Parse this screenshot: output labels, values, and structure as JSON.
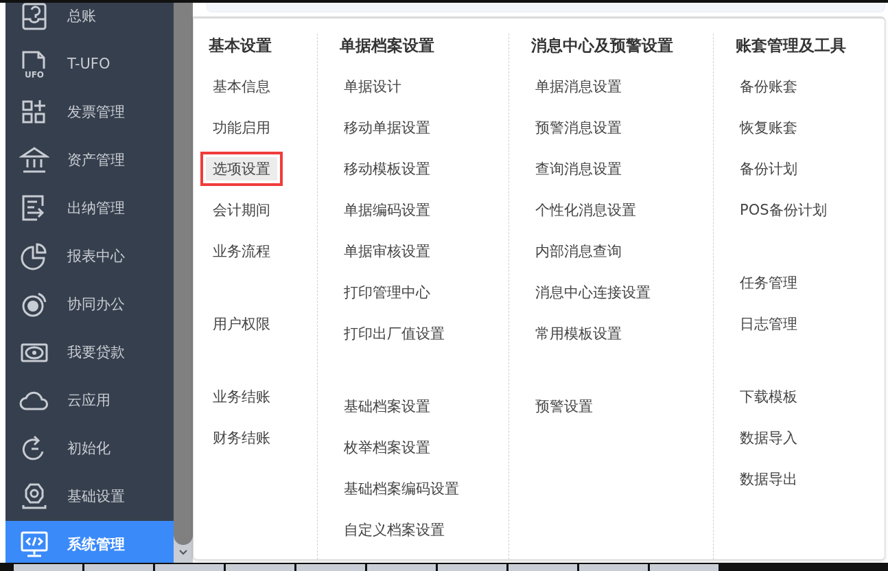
{
  "sidebar": {
    "items": [
      {
        "label": "总账",
        "selected": false
      },
      {
        "label": "T-UFO",
        "icon_label": "UFO",
        "selected": false
      },
      {
        "label": "发票管理",
        "selected": false
      },
      {
        "label": "资产管理",
        "selected": false
      },
      {
        "label": "出纳管理",
        "selected": false
      },
      {
        "label": "报表中心",
        "selected": false
      },
      {
        "label": "协同办公",
        "selected": false
      },
      {
        "label": "我要贷款",
        "selected": false
      },
      {
        "label": "云应用",
        "selected": false
      },
      {
        "label": "初始化",
        "selected": false
      },
      {
        "label": "基础设置",
        "selected": false
      },
      {
        "label": "系统管理",
        "selected": true
      }
    ]
  },
  "menu": {
    "columns": [
      {
        "heading": "基本设置",
        "groups": [
          [
            {
              "label": "基本信息",
              "selected": false
            },
            {
              "label": "功能启用",
              "selected": false
            },
            {
              "label": "选项设置",
              "selected": true
            },
            {
              "label": "会计期间",
              "selected": false
            },
            {
              "label": "业务流程",
              "selected": false
            }
          ],
          [
            {
              "label": "用户权限",
              "selected": false
            }
          ],
          [
            {
              "label": "业务结账",
              "selected": false
            },
            {
              "label": "财务结账",
              "selected": false
            }
          ]
        ]
      },
      {
        "heading": "单据档案设置",
        "groups": [
          [
            {
              "label": "单据设计",
              "selected": false
            },
            {
              "label": "移动单据设置",
              "selected": false
            },
            {
              "label": "移动模板设置",
              "selected": false
            },
            {
              "label": "单据编码设置",
              "selected": false
            },
            {
              "label": "单据审核设置",
              "selected": false
            },
            {
              "label": "打印管理中心",
              "selected": false
            },
            {
              "label": "打印出厂值设置",
              "selected": false
            }
          ],
          [
            {
              "label": "基础档案设置",
              "selected": false
            },
            {
              "label": "枚举档案设置",
              "selected": false
            },
            {
              "label": "基础档案编码设置",
              "selected": false
            },
            {
              "label": "自定义档案设置",
              "selected": false
            }
          ]
        ]
      },
      {
        "heading": "消息中心及预警设置",
        "groups": [
          [
            {
              "label": "单据消息设置",
              "selected": false
            },
            {
              "label": "预警消息设置",
              "selected": false
            },
            {
              "label": "查询消息设置",
              "selected": false
            },
            {
              "label": "个性化消息设置",
              "selected": false
            },
            {
              "label": "内部消息查询",
              "selected": false
            },
            {
              "label": "消息中心连接设置",
              "selected": false
            },
            {
              "label": "常用模板设置",
              "selected": false
            }
          ],
          [
            {
              "label": "预警设置",
              "selected": false
            }
          ]
        ]
      },
      {
        "heading": "账套管理及工具",
        "groups": [
          [
            {
              "label": "备份账套",
              "selected": false
            },
            {
              "label": "恢复账套",
              "selected": false
            },
            {
              "label": "备份计划",
              "selected": false
            },
            {
              "label": "POS备份计划",
              "selected": false
            }
          ],
          [
            {
              "label": "任务管理",
              "selected": false
            },
            {
              "label": "日志管理",
              "selected": false
            }
          ],
          [
            {
              "label": "下载模板",
              "selected": false
            },
            {
              "label": "数据导入",
              "selected": false
            },
            {
              "label": "数据导出",
              "selected": false
            }
          ]
        ]
      }
    ]
  }
}
